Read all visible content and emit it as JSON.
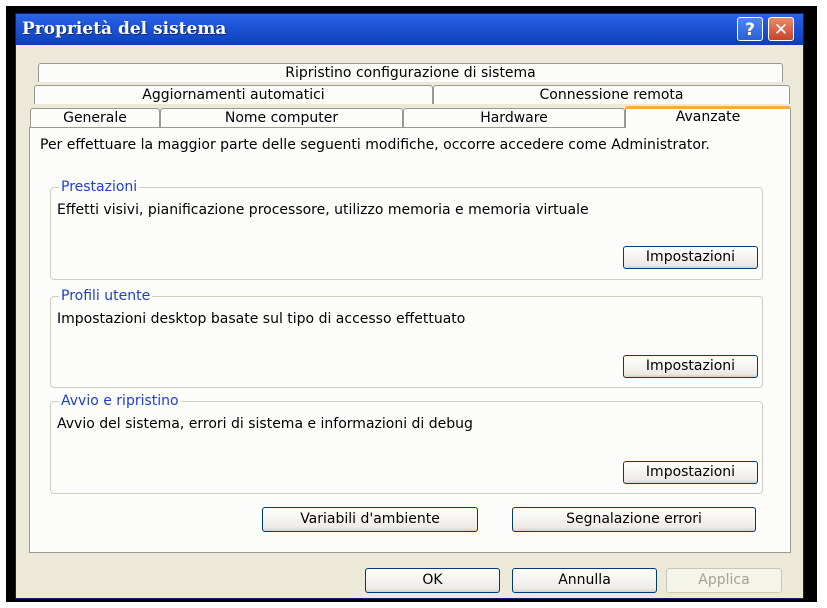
{
  "window": {
    "title": "Proprietà del sistema",
    "help_label": "?",
    "close_label": "✕"
  },
  "tabs": {
    "row1": [
      "Ripristino configurazione di sistema"
    ],
    "row2": [
      "Aggiornamenti automatici",
      "Connessione remota"
    ],
    "row3": [
      "Generale",
      "Nome computer",
      "Hardware"
    ],
    "active": "Avanzate"
  },
  "panel": {
    "intro": "Per effettuare la maggior parte delle seguenti modifiche, occorre accedere come Administrator.",
    "groups": [
      {
        "title": "Prestazioni",
        "description": "Effetti visivi, pianificazione processore, utilizzo memoria e memoria virtuale",
        "button": "Impostazioni"
      },
      {
        "title": "Profili utente",
        "description": "Impostazioni desktop basate sul tipo di accesso effettuato",
        "button": "Impostazioni"
      },
      {
        "title": "Avvio e ripristino",
        "description": "Avvio del sistema, errori di sistema e informazioni di debug",
        "button": "Impostazioni"
      }
    ],
    "env_button": "Variabili d'ambiente",
    "error_button": "Segnalazione errori"
  },
  "footer": {
    "ok": "OK",
    "cancel": "Annulla",
    "apply": "Applica"
  },
  "colors": {
    "titlebar": "#1d54d6",
    "active_tab_accent": "#f2b134",
    "group_title": "#1e3fc8",
    "window_bg": "#ece9d8"
  }
}
